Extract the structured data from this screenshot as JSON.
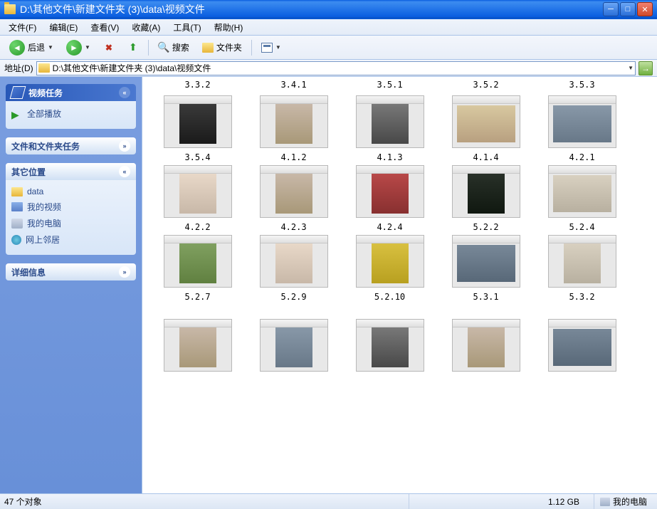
{
  "titlebar": {
    "path": "D:\\其他文件\\新建文件夹 (3)\\data\\视频文件"
  },
  "menu": {
    "file": "文件(F)",
    "edit": "编辑(E)",
    "view": "查看(V)",
    "fav": "收藏(A)",
    "tools": "工具(T)",
    "help": "帮助(H)"
  },
  "toolbar": {
    "back": "后退",
    "search": "搜索",
    "folders": "文件夹"
  },
  "address": {
    "label": "地址(D)",
    "value": "D:\\其他文件\\新建文件夹 (3)\\data\\视频文件"
  },
  "sidebar": {
    "tasks": {
      "title": "视频任务",
      "play_all": "全部播放"
    },
    "files": {
      "title": "文件和文件夹任务"
    },
    "places": {
      "title": "其它位置",
      "items": [
        {
          "label": "data",
          "ico": "ico-fld"
        },
        {
          "label": "我的视频",
          "ico": "ico-vid"
        },
        {
          "label": "我的电脑",
          "ico": "ico-pc"
        },
        {
          "label": "网上邻居",
          "ico": "ico-net"
        }
      ]
    },
    "details": {
      "title": "详细信息"
    }
  },
  "toprow_labels": [
    "3.3.2",
    "3.4.1",
    "3.5.1",
    "3.5.2",
    "3.5.3"
  ],
  "rows": [
    {
      "names": [
        "3.5.4",
        "4.1.2",
        "4.1.3",
        "4.1.4",
        "4.2.1"
      ],
      "sw": [
        "s1",
        "s2",
        "s3",
        "s4",
        "s5"
      ],
      "wide": [
        false,
        false,
        false,
        true,
        true
      ]
    },
    {
      "names": [
        "4.2.2",
        "4.2.3",
        "4.2.4",
        "5.2.2",
        "5.2.4"
      ],
      "sw": [
        "s6",
        "s2",
        "s7",
        "s8",
        "s9"
      ],
      "wide": [
        false,
        false,
        false,
        false,
        true
      ]
    },
    {
      "names": [
        "5.2.7",
        "5.2.9",
        "5.2.10",
        "5.3.1",
        "5.3.2"
      ],
      "sw": [
        "s10",
        "s6",
        "s11",
        "s12",
        "s9"
      ],
      "wide": [
        false,
        false,
        false,
        true,
        false
      ]
    }
  ],
  "lastrow": {
    "sw": [
      "s2",
      "s5",
      "s3",
      "s2",
      "s12"
    ],
    "wide": [
      false,
      false,
      false,
      false,
      true
    ]
  },
  "statusbar": {
    "count": "47 个对象",
    "size": "1.12 GB",
    "location": "我的电脑"
  }
}
